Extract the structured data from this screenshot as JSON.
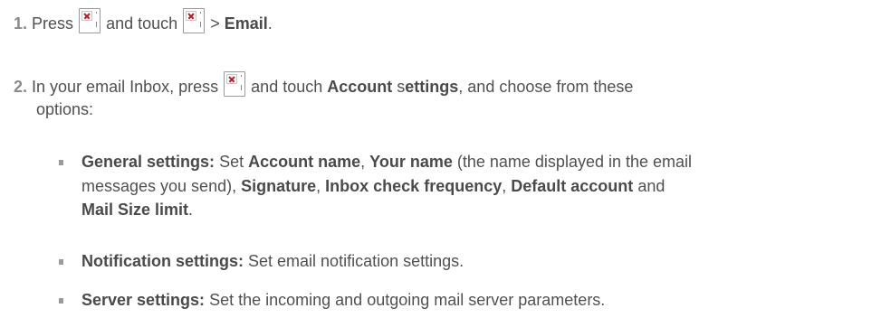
{
  "steps": [
    {
      "number": "1.",
      "press": "Press",
      "and_touch": "and touch",
      "arrow": ">",
      "email": "Email",
      "period": "."
    },
    {
      "number": "2.",
      "text_a": "In your email Inbox, press",
      "text_b": "and touch",
      "account": "Account",
      "settings_s": "s",
      "settings_rest": "ettings",
      "text_c": ", and choose from these",
      "text_d": "options:"
    }
  ],
  "options": [
    {
      "title": "General settings:",
      "set": "Set",
      "account_name": "Account name",
      "comma1": ",",
      "your_name": "Your name",
      "desc1": "(the name displayed in the email",
      "desc2": "messages you send),",
      "signature": "Signature",
      "comma2": ",",
      "inbox_check": "Inbox check frequency",
      "comma3": ",",
      "default_account": "Default account",
      "and": "and",
      "mail_size": "Mail Size limit",
      "period": "."
    },
    {
      "title": "Notification settings:",
      "desc": "Set email notification settings."
    },
    {
      "title": "Server settings:",
      "desc": "Set the incoming and outgoing mail server parameters."
    }
  ],
  "icon_name": "menu-key-icon"
}
